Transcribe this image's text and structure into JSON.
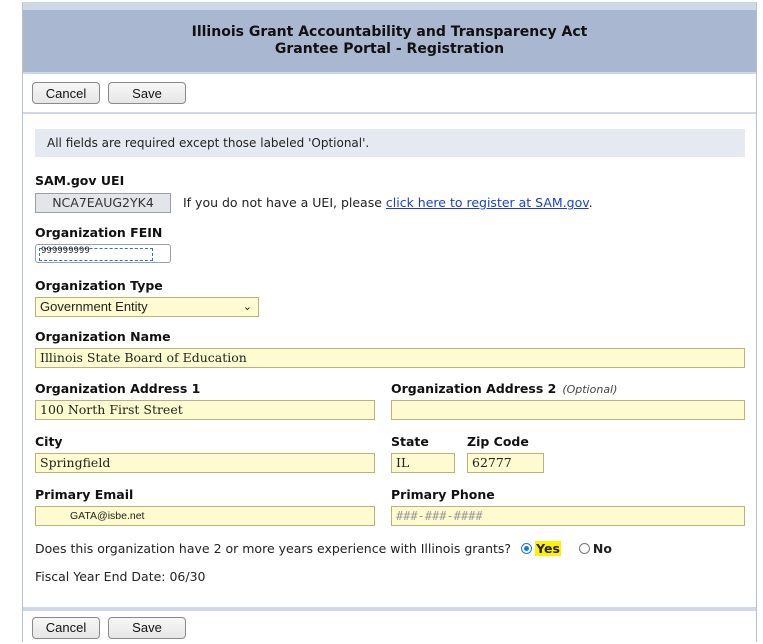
{
  "header": {
    "title_line1": "Illinois Grant Accountability and Transparency Act",
    "title_line2": "Grantee Portal - Registration"
  },
  "toolbar": {
    "cancel_label": "Cancel",
    "save_label": "Save"
  },
  "form": {
    "required_note": "All fields are required except those labeled 'Optional'.",
    "uei": {
      "label": "SAM.gov UEI",
      "value": "NCA7EAUG2YK4",
      "help_prefix": "If you do not have a UEI, please",
      "help_link": "click here to register at SAM.gov",
      "help_suffix": "."
    },
    "fein": {
      "label": "Organization FEIN",
      "value": "999999999"
    },
    "org_type": {
      "label": "Organization Type",
      "selected": "Government Entity"
    },
    "org_name": {
      "label": "Organization Name",
      "value": "Illinois State Board of Education"
    },
    "address1": {
      "label": "Organization Address 1",
      "value": "100 North First Street"
    },
    "address2": {
      "label": "Organization Address 2",
      "optional": "(Optional)",
      "value": ""
    },
    "city": {
      "label": "City",
      "value": "Springfield"
    },
    "state": {
      "label": "State",
      "value": "IL"
    },
    "zip": {
      "label": "Zip Code",
      "value": "62777"
    },
    "email": {
      "label": "Primary Email",
      "value": "GATA@isbe.net"
    },
    "phone": {
      "label": "Primary Phone",
      "placeholder": "###-###-####",
      "value": ""
    },
    "experience": {
      "question": "Does this organization have 2 or more years experience with Illinois grants?",
      "yes_label": "Yes",
      "no_label": "No",
      "selected": "Yes"
    },
    "fiscal_year_end": "Fiscal Year End Date: 06/30"
  }
}
